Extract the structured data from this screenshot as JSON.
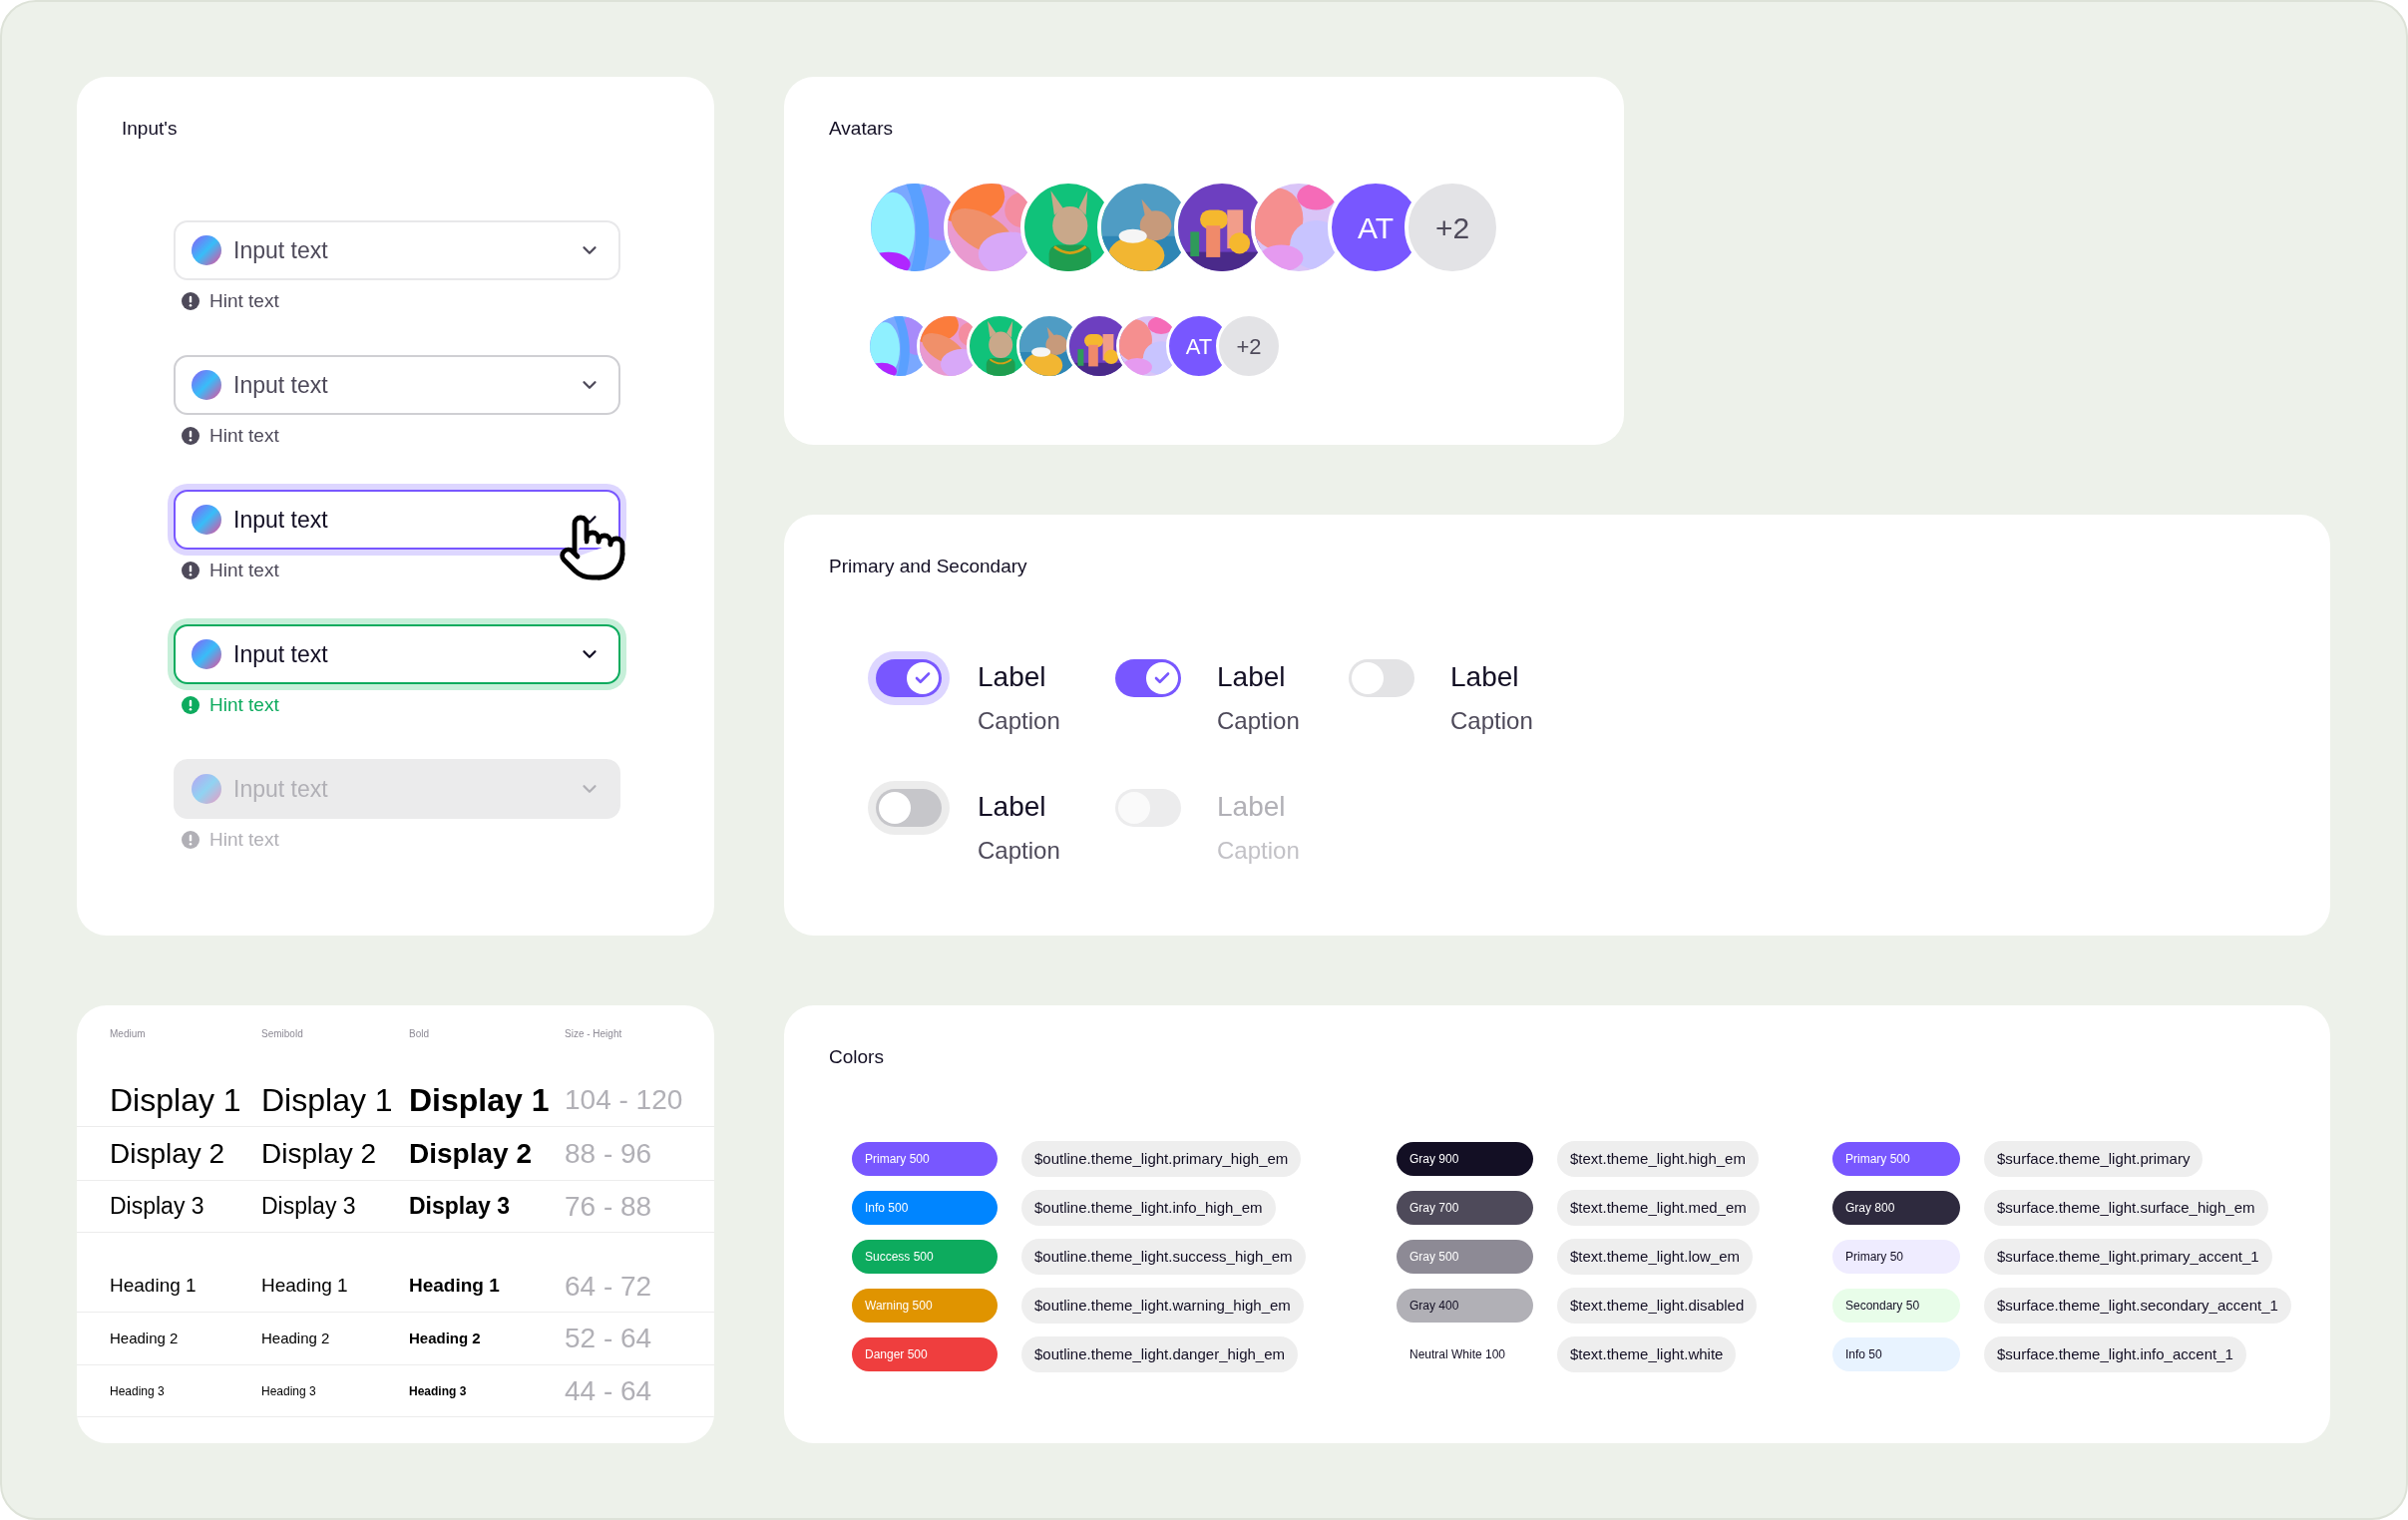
{
  "inputs": {
    "title": "Input's",
    "fields": [
      {
        "kind": "default",
        "value": "Input text",
        "hint": "Hint text"
      },
      {
        "kind": "hover",
        "value": "Input text",
        "hint": "Hint text"
      },
      {
        "kind": "focused",
        "value": "Input text",
        "hint": "Hint text"
      },
      {
        "kind": "success",
        "value": "Input text",
        "hint": "Hint text"
      },
      {
        "kind": "disabled",
        "value": "Input text",
        "hint": "Hint text"
      }
    ]
  },
  "avatars": {
    "title": "Avatars",
    "groups": [
      {
        "kind": "large",
        "items": [
          {
            "kind": "picture"
          },
          {
            "kind": "picture"
          },
          {
            "kind": "picture"
          },
          {
            "kind": "picture"
          },
          {
            "kind": "picture"
          },
          {
            "kind": "picture"
          },
          {
            "kind": "initials",
            "text": "AT"
          },
          {
            "kind": "overflow",
            "text": "+2"
          }
        ]
      },
      {
        "kind": "small",
        "items": [
          {
            "kind": "picture"
          },
          {
            "kind": "picture"
          },
          {
            "kind": "picture"
          },
          {
            "kind": "picture"
          },
          {
            "kind": "picture"
          },
          {
            "kind": "picture"
          },
          {
            "kind": "initials",
            "text": "AT"
          },
          {
            "kind": "overflow",
            "text": "+2"
          }
        ]
      }
    ]
  },
  "switches": {
    "title": "Primary and Secondary",
    "rows": [
      {
        "items": [
          {
            "label": "Label",
            "caption": "Caption",
            "on": true,
            "focused": true,
            "disabled": false
          },
          {
            "label": "Label",
            "caption": "Caption",
            "on": true,
            "focused": false,
            "disabled": false
          },
          {
            "label": "Label",
            "caption": "Caption",
            "on": false,
            "focused": false,
            "disabled": false
          }
        ]
      },
      {
        "items": [
          {
            "label": "Label",
            "caption": "Caption",
            "on": false,
            "focused": true,
            "disabled": false
          },
          {
            "label": "Label",
            "caption": "Caption",
            "on": false,
            "focused": false,
            "disabled": true
          }
        ]
      }
    ]
  },
  "typography": {
    "columns": [
      "Medium",
      "Semibold",
      "Bold",
      "Size - Height"
    ],
    "groups": [
      {
        "kind": "display",
        "rows": [
          {
            "cells": [
              "Display 1",
              "Display 1",
              "Display 1"
            ],
            "size": "104 - 120"
          },
          {
            "cells": [
              "Display 2",
              "Display 2",
              "Display 2"
            ],
            "size": "88 - 96"
          },
          {
            "cells": [
              "Display 3",
              "Display 3",
              "Display 3"
            ],
            "size": "76 - 88"
          }
        ]
      },
      {
        "kind": "heading",
        "rows": [
          {
            "cells": [
              "Heading 1",
              "Heading 1",
              "Heading 1"
            ],
            "size": "64 - 72"
          },
          {
            "cells": [
              "Heading 2",
              "Heading 2",
              "Heading 2"
            ],
            "size": "52 - 64"
          },
          {
            "cells": [
              "Heading 3",
              "Heading 3",
              "Heading 3"
            ],
            "size": "44 - 64"
          }
        ]
      }
    ]
  },
  "colors": {
    "title": "Colors",
    "groups": [
      {
        "rows": [
          {
            "swatch": "Primary 500",
            "color": "#7857ff",
            "token": "$outline.theme_light.primary_high_em"
          },
          {
            "swatch": "Info 500",
            "color": "#0085ff",
            "token": "$outline.theme_light.info_high_em"
          },
          {
            "swatch": "Success 500",
            "color": "#0dab5e",
            "token": "$outline.theme_light.success_high_em"
          },
          {
            "swatch": "Warning 500",
            "color": "#e09400",
            "token": "$outline.theme_light.warning_high_em"
          },
          {
            "swatch": "Danger 500",
            "color": "#ef3e3e",
            "token": "$outline.theme_light.danger_high_em"
          }
        ]
      },
      {
        "rows": [
          {
            "swatch": "Gray 900",
            "color": "#130f24",
            "token": "$text.theme_light.high_em"
          },
          {
            "swatch": "Gray 700",
            "color": "#4e4a5a",
            "token": "$text.theme_light.med_em"
          },
          {
            "swatch": "Gray 500",
            "color": "#8d8a95",
            "token": "$text.theme_light.low_em"
          },
          {
            "swatch": "Gray 400",
            "color": "#b1b0b6",
            "token": "$text.theme_light.disabled"
          },
          {
            "swatch": "Neutral White 100",
            "color": "#ffffff",
            "token": "$text.theme_light.white"
          }
        ]
      },
      {
        "rows": [
          {
            "swatch": "Primary 500",
            "color": "#7857ff",
            "token": "$surface.theme_light.primary"
          },
          {
            "swatch": "Gray 800",
            "color": "#2e2a3e",
            "token": "$surface.theme_light.surface_high_em"
          },
          {
            "swatch": "Primary 50",
            "color": "#efecff",
            "token": "$surface.theme_light.primary_accent_1"
          },
          {
            "swatch": "Secondary 50",
            "color": "#e8fde9",
            "token": "$surface.theme_light.secondary_accent_1"
          },
          {
            "swatch": "Info 50",
            "color": "#e8f3ff",
            "token": "$surface.theme_light.info_accent_1"
          }
        ]
      }
    ]
  }
}
